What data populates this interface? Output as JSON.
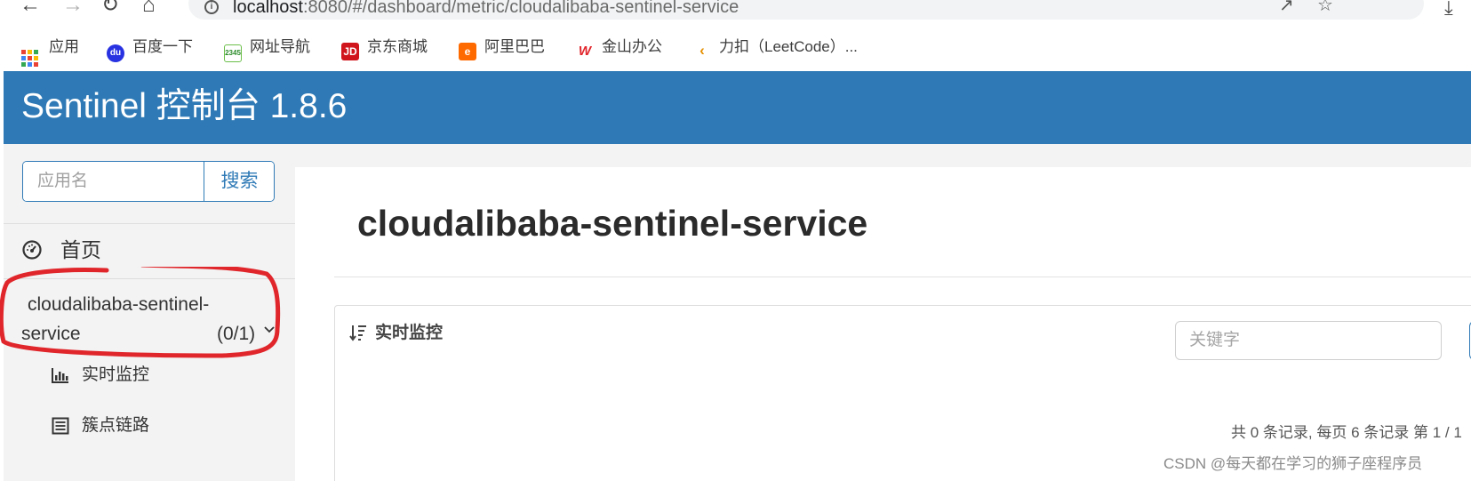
{
  "browser": {
    "url_host": "localhost",
    "url_path": ":8080/#/dashboard/metric/cloudalibaba-sentinel-service",
    "bookmarks": [
      {
        "label": "应用",
        "icon": "apps-grid-icon"
      },
      {
        "label": "百度一下",
        "icon": "baidu-icon"
      },
      {
        "label": "网址导航",
        "icon": "hao2345-icon"
      },
      {
        "label": "京东商城",
        "icon": "jd-icon"
      },
      {
        "label": "阿里巴巴",
        "icon": "alibaba-icon"
      },
      {
        "label": "金山办公",
        "icon": "wps-icon"
      },
      {
        "label": "力扣（LeetCode）...",
        "icon": "leetcode-icon"
      }
    ]
  },
  "header": {
    "title": "Sentinel 控制台 1.8.6",
    "background_color": "#2f7ab6"
  },
  "sidebar": {
    "search_placeholder": "应用名",
    "search_button": "搜索",
    "home_label": "首页",
    "app": {
      "name_line1": "cloudalibaba-sentinel-",
      "name_line2": "service",
      "count": "(0/1)"
    },
    "sub_items": [
      {
        "label": "实时监控",
        "icon": "bar-chart-icon"
      },
      {
        "label": "簇点链路",
        "icon": "list-icon"
      }
    ]
  },
  "main": {
    "page_title": "cloudalibaba-sentinel-service",
    "panel_title": "实时监控",
    "keyword_placeholder": "关键字",
    "pagination": "共 0 条记录, 每页 6 条记录 第 1 / 1"
  },
  "watermark": "CSDN @每天都在学习的狮子座程序员",
  "annotation_color": "#e0262b"
}
